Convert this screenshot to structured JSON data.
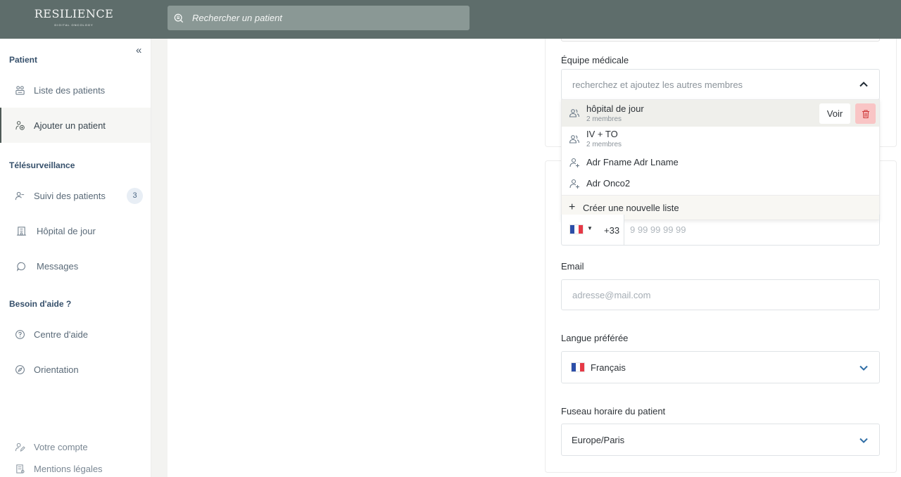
{
  "app": {
    "logo_main": "RESILIENCE",
    "logo_sub": "DIGITAL ONCOLOGY",
    "search_placeholder": "Rechercher un patient"
  },
  "sidebar": {
    "sections": [
      {
        "title": "Patient"
      },
      {
        "title": "Télésurveillance"
      },
      {
        "title": "Besoin d'aide ?"
      }
    ],
    "items": [
      {
        "label": "Liste des patients",
        "icon": "patients-list-icon"
      },
      {
        "label": "Ajouter un patient",
        "icon": "add-patient-icon",
        "active": true
      },
      {
        "label": "Suivi des patients",
        "icon": "user-follow-icon",
        "badge": "3"
      },
      {
        "label": "Hôpital de jour",
        "icon": "building-icon"
      },
      {
        "label": "Messages",
        "icon": "chat-bubble-icon"
      },
      {
        "label": "Centre d'aide",
        "icon": "help-circle-icon"
      },
      {
        "label": "Orientation",
        "icon": "compass-icon"
      }
    ],
    "footer": [
      {
        "label": "Votre compte",
        "icon": "user-edit-icon"
      },
      {
        "label": "Mentions légales",
        "icon": "legal-doc-icon"
      }
    ]
  },
  "form": {
    "medical_team": {
      "label": "Équipe médicale",
      "placeholder": "recherchez et ajoutez les autres membres",
      "options": [
        {
          "name": "hôpital de jour",
          "sub": "2 membres",
          "type": "group",
          "highlighted": true
        },
        {
          "name": "IV + TO",
          "sub": "2 membres",
          "type": "group"
        },
        {
          "name": "Adr Fname Adr Lname",
          "sub": "",
          "type": "person"
        },
        {
          "name": "Adr Onco2",
          "sub": "",
          "type": "person"
        }
      ],
      "voir_label": "Voir",
      "create_label": "Créer une nouvelle liste"
    },
    "phone": {
      "country_code": "+33",
      "placeholder": "9 99 99 99 99"
    },
    "email": {
      "label": "Email",
      "placeholder": "adresse@mail.com"
    },
    "language": {
      "label": "Langue préférée",
      "value": "Français"
    },
    "timezone": {
      "label": "Fuseau horaire du patient",
      "value": "Europe/Paris"
    }
  },
  "colors": {
    "topbar": "#5e6d6b",
    "accent": "#36506b",
    "chevron": "#2f6ea6",
    "delete": "#f9c5c5"
  }
}
